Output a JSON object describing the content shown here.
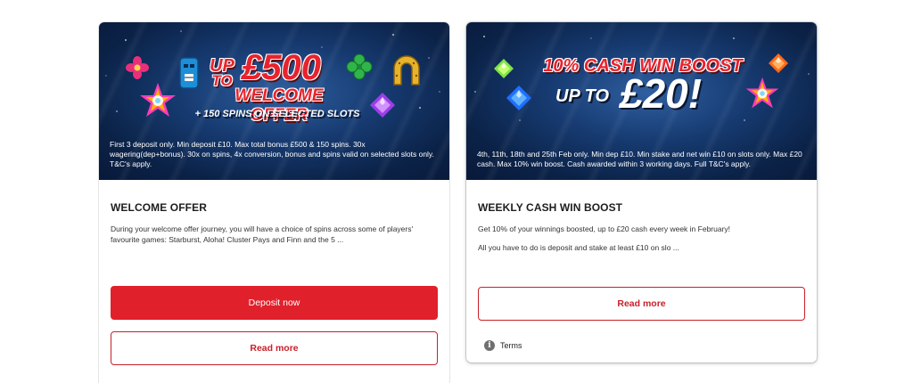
{
  "colors": {
    "brand_red": "#e0202b",
    "outline_red": "#c8202a",
    "banner_blue": "#163a70"
  },
  "cards": [
    {
      "banner": {
        "line1": "UP",
        "line2": "TO",
        "amount": "£500",
        "line3": "WELCOME OFFER",
        "line4": "+ 150 SPINS ON SELECTED SLOTS",
        "terms": "First 3 deposit only. Min deposit £10. Max total bonus £500 & 150 spins. 30x wagering(dep+bonus). 30x on spins, 4x conversion, bonus and spins valid on selected slots only. T&C's apply.",
        "icons": [
          "flower-icon",
          "tiki-mask-icon",
          "starburst-gem-icon",
          "clover-icon",
          "horseshoe-icon",
          "purple-gem-icon"
        ]
      },
      "title": "WELCOME OFFER",
      "description": "During your welcome offer journey, you will have a choice of spins across some of players' favourite games: Starburst, Aloha! Cluster Pays and Finn and the 5 ...",
      "primary_button": "Deposit now",
      "secondary_button": "Read more"
    },
    {
      "banner": {
        "line1": "10% CASH WIN BOOST",
        "line2": "UP TO",
        "amount": "£20!",
        "terms": "4th, 11th, 18th and 25th Feb only. Min dep £10. Min stake and net win £10 on slots only. Max £20 cash. Max 10% win boost. Cash awarded within 3 working days. Full T&C's apply.",
        "icons": [
          "green-gem-icon",
          "blue-gem-icon",
          "orange-gem-icon",
          "starburst-gem-icon"
        ]
      },
      "title": "WEEKLY CASH WIN BOOST",
      "paragraph1": "Get 10% of your winnings boosted, up to £20 cash every week in February!",
      "paragraph2": "All you have to do is deposit and stake at least £10 on slo ...",
      "secondary_button": "Read more",
      "terms_link": "Terms"
    }
  ]
}
